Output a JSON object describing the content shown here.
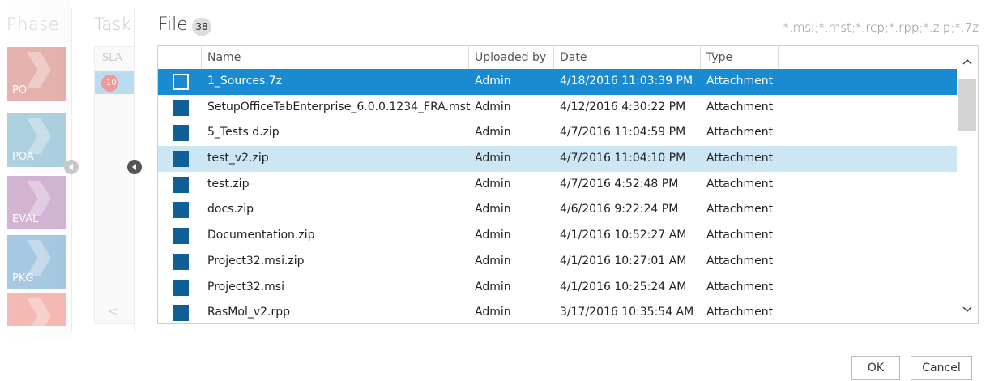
{
  "background": {
    "phase_title": "Phase",
    "phases": [
      {
        "label": "PO",
        "color": "#c0392b"
      },
      {
        "label": "POA",
        "color": "#2c88b3"
      },
      {
        "label": "EVAL",
        "color": "#8e3f8f"
      },
      {
        "label": "PKG",
        "color": "#1d73b5"
      },
      {
        "label": "",
        "color": "#e74c3c"
      }
    ],
    "task_title": "Task",
    "sla_label": "SLA",
    "sla_badge": "-10"
  },
  "dialog": {
    "title": "File",
    "count": "38",
    "filter": "*.msi;*.mst;*.rcp;*.rpp;*.zip;*.7z",
    "columns": [
      "Name",
      "Uploaded by",
      "Date",
      "Type"
    ],
    "rows": [
      {
        "name": "1_Sources.7z",
        "uploaded_by": "Admin",
        "date": "4/18/2016 11:03:39 PM",
        "type": "Attachment",
        "state": "selected"
      },
      {
        "name": "SetupOfficeTabEnterprise_6.0.0.1234_FRA.mst",
        "uploaded_by": "Admin",
        "date": "4/12/2016 4:30:22 PM",
        "type": "Attachment",
        "state": ""
      },
      {
        "name": "5_Tests d.zip",
        "uploaded_by": "Admin",
        "date": "4/7/2016 11:04:59 PM",
        "type": "Attachment",
        "state": ""
      },
      {
        "name": "test_v2.zip",
        "uploaded_by": "Admin",
        "date": "4/7/2016 11:04:10 PM",
        "type": "Attachment",
        "state": "highlight"
      },
      {
        "name": "test.zip",
        "uploaded_by": "Admin",
        "date": "4/7/2016 4:52:48 PM",
        "type": "Attachment",
        "state": ""
      },
      {
        "name": "docs.zip",
        "uploaded_by": "Admin",
        "date": "4/6/2016 9:22:24 PM",
        "type": "Attachment",
        "state": ""
      },
      {
        "name": "Documentation.zip",
        "uploaded_by": "Admin",
        "date": "4/1/2016 10:52:27 AM",
        "type": "Attachment",
        "state": ""
      },
      {
        "name": "Project32.msi.zip",
        "uploaded_by": "Admin",
        "date": "4/1/2016 10:27:01 AM",
        "type": "Attachment",
        "state": ""
      },
      {
        "name": "Project32.msi",
        "uploaded_by": "Admin",
        "date": "4/1/2016 10:25:24 AM",
        "type": "Attachment",
        "state": ""
      },
      {
        "name": "RasMol_v2.rpp",
        "uploaded_by": "Admin",
        "date": "3/17/2016 10:35:54 AM",
        "type": "Attachment",
        "state": ""
      }
    ],
    "ok_label": "OK",
    "cancel_label": "Cancel",
    "icons": {
      "scroll_up": "chevron-up-icon",
      "scroll_down": "chevron-down-icon",
      "collapse": "chevron-left-icon"
    },
    "colors": {
      "accent": "#1a8bd0",
      "highlight": "#cde6f4",
      "checkbox": "#0f5f99"
    }
  }
}
